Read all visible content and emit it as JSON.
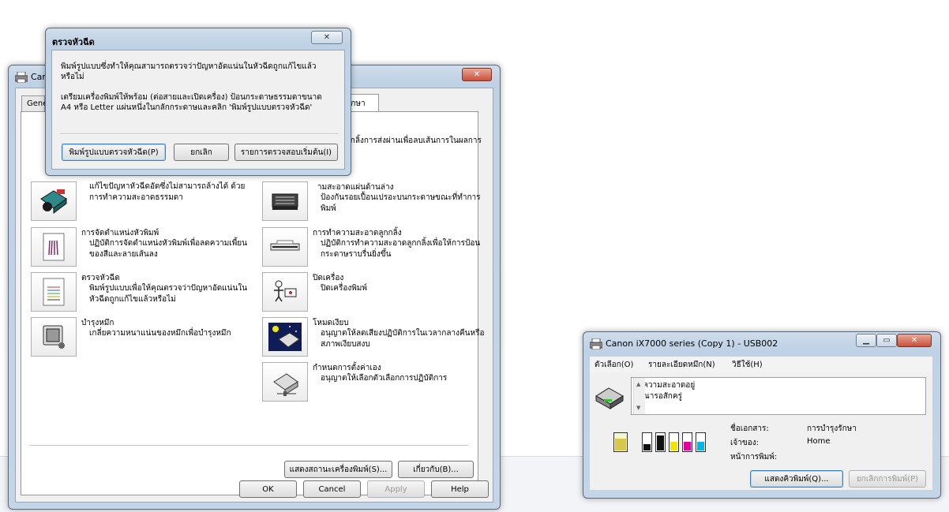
{
  "properties": {
    "title": "Canon",
    "tabs": [
      "Gene",
      "รักษา"
    ],
    "items_left": [
      {
        "title": "",
        "desc": "แก้ไขปัญหาหัวฉีดอัดซึ่งไม่สามารถล้างได้ ด้วยการทำความสะอาดธรรมดา",
        "icon": "deep-cleaning-icon"
      },
      {
        "title": "การจัดตำแหน่งหัวพิมพ์",
        "desc": "ปฏิบัติการจัดตำแหน่งหัวพิมพ์เพื่อลดความเพี้ยนของสีและลายเส้นลง",
        "icon": "print-head-alignment-icon"
      },
      {
        "title": "ตรวจหัวฉีด",
        "desc": "พิมพ์รูปแบบเพื่อให้คุณตรวจว่าปัญหาอัดแน่นในหัวฉีดถูกแก้ไขแล้วหรือไม่",
        "icon": "nozzle-check-icon"
      },
      {
        "title": "บำรุงหมึก",
        "desc": "เกลี่ยความหนาแน่นของหมึกเพื่อบำรุงหมึก",
        "icon": "ink-maintenance-icon"
      }
    ],
    "items_right": [
      {
        "title": "",
        "desc": "สะอาดลูกกลิ้งการส่งผ่านเพื่อลบเส้นการในผลการพิมพ์",
        "icon": "roller-cleaning-icon"
      },
      {
        "title": "ามสะอาดแผ่นด้านล่าง",
        "desc": "ป้องกันรอยเปื้อนเปรอะบนกระดาษขณะที่ทำการพิมพ์",
        "icon": "bottom-plate-cleaning-icon"
      },
      {
        "title": "การทำความสะอาดลูกกลิ้ง",
        "desc": "ปฏิบัติการทำความสะอาดลูกกลิ้งเพื่อให้การป้อนกระดาษราบรื่นยิ่งขึ้น",
        "icon": "paper-feed-roller-icon"
      },
      {
        "title": "ปิดเครื่อง",
        "desc": "ปิดเครื่องพิมพ์",
        "icon": "power-off-icon"
      },
      {
        "title": "โหมดเงียบ",
        "desc": "อนุญาตให้ลดเสียงปฏิบัติการในเวลากลางคืนหรือสภาพเงียบสงบ",
        "icon": "quiet-mode-icon"
      },
      {
        "title": "กำหนดการตั้งค่าเอง",
        "desc": "อนุญาตให้เลือกตัวเลือกการปฏิบัติการ",
        "icon": "custom-settings-icon"
      }
    ],
    "status_button": "แสดงสถานะเครื่องพิมพ์(S)...",
    "about_button": "เกี่ยวกับ(B)...",
    "ok": "OK",
    "cancel": "Cancel",
    "apply": "Apply",
    "help": "Help"
  },
  "nozzle_dialog": {
    "title": "ตรวจหัวฉีด",
    "line1": "พิมพ์รูปแบบซึ่งทำให้คุณสามารถตรวจว่าปัญหาอัดแน่นในหัวฉีดถูกแก้ไขแล้วหรือไม่",
    "line2": "เตรียมเครื่องพิมพ์ให้พร้อม (ต่อสายและเปิดเครื่อง) ป้อนกระดาษธรรมดาขนาด A4 หรือ Letter แผ่นหนึ่งในกลักกระดาษและคลิก 'พิมพ์รูปแบบตรวจหัวฉีด'",
    "print_button": "พิมพ์รูปแบบตรวจหัวฉีด(P)",
    "cancel_button": "ยกเลิก",
    "initial_check_button": "รายการตรวจสอบเริ่มต้น(I)"
  },
  "monitor": {
    "title": "Canon iX7000 series (Copy 1) - USB002",
    "menus": [
      "ตัวเลือก(O)",
      "รายละเอียดหมึก(N)",
      "วิธีใช้(H)"
    ],
    "message_line1": "ทำความสะอาดอยู่",
    "message_line2": "กรุณารอสักครู่",
    "doc_name_label": "ชื่อเอกสาร:",
    "doc_name_value": "การบำรุงรักษา",
    "owner_label": "เจ้าของ:",
    "owner_value": "Home",
    "pages_label": "หน้าการพิมพ์:",
    "display_queue_button": "แสดงคิวพิมพ์(Q)...",
    "cancel_printing_button": "ยกเลิกการพิมพ์(P)",
    "inks": [
      {
        "name": "yellow-tank",
        "color": "#d6c84a",
        "level": 0.7
      },
      {
        "name": "black-1",
        "color": "#111111",
        "level": 0.4
      },
      {
        "name": "black-2",
        "color": "#111111",
        "level": 0.9
      },
      {
        "name": "yellow",
        "color": "#f2e600",
        "level": 0.5
      },
      {
        "name": "magenta",
        "color": "#e0009a",
        "level": 0.5
      },
      {
        "name": "cyan",
        "color": "#00b8e6",
        "level": 0.5
      }
    ]
  }
}
